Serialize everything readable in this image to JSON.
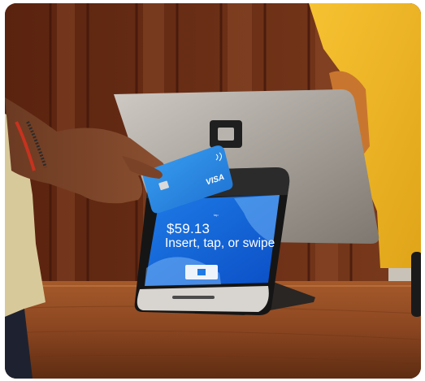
{
  "scene": {
    "payment_screen": {
      "amount": "$59.13",
      "prompt": "Insert, tap, or swipe",
      "tap_label": "tap"
    },
    "card": {
      "brand": "VISA"
    }
  }
}
